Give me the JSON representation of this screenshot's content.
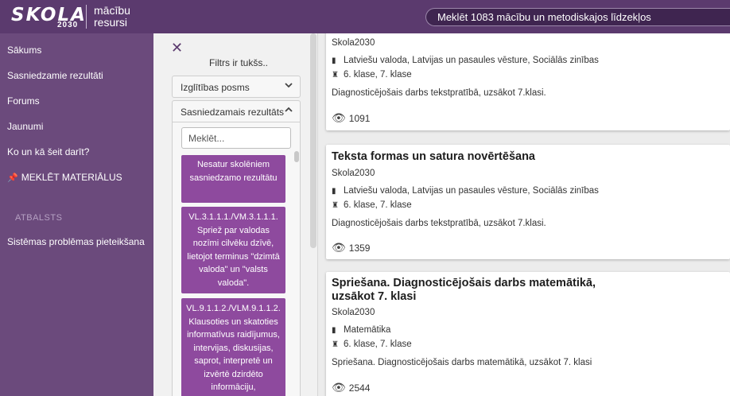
{
  "header": {
    "logo_word": "SKOLA",
    "logo_year": "2030",
    "logo_sub_line1": "mācību",
    "logo_sub_line2": "resursi",
    "search_placeholder": "Meklēt 1083 mācību un metodiskajos līdzekļos",
    "brand_color": "#5b3a6e"
  },
  "sidebar": {
    "items": [
      {
        "label": "Sākums"
      },
      {
        "label": "Sasniedzamie rezultāti"
      },
      {
        "label": "Forums"
      },
      {
        "label": "Jaunumi"
      },
      {
        "label": "Ko un kā šeit darīt?"
      },
      {
        "label": "MEKLĒT MATERIĀLUS",
        "icon": "pin-icon"
      }
    ],
    "section_label": "ATBALSTS",
    "support_items": [
      {
        "label": "Sistēmas problēmas pieteikšana"
      }
    ]
  },
  "filters": {
    "close_icon": "close-icon",
    "empty_text": "Filtrs ir tukšs..",
    "accordions": [
      {
        "label": "Izglītības posms",
        "state": "collapsed"
      },
      {
        "label": "Sasniedzamais rezultāts",
        "state": "expanded"
      }
    ],
    "mini_search_placeholder": "Meklēt...",
    "options": [
      {
        "text": "Nesatur skolēniem sasniedzamo rezultātu"
      },
      {
        "text": "VL.3.1.1.1./VM.3.1.1.1. Spriež par valodas nozīmi cilvēku dzīvē, lietojot terminus \"dzimtā valoda\" un \"valsts valoda\"."
      },
      {
        "text": "VL.9.1.1.2./VLM.9.1.1.2. Klausoties un skatoties informatīvus raidījumus, intervijas, diskusijas, saprot, interpretē un izvērtē dzirdēto informāciju,"
      }
    ],
    "option_color": "#8e4a9e"
  },
  "cards": [
    {
      "title": "",
      "author": "Skola2030",
      "subjects": "Latviešu valoda, Latvijas un pasaules vēsture, Sociālās zinības",
      "grades": "6. klase, 7. klase",
      "description": "Diagnosticējošais darbs tekstpratībā, uzsākot 7.klasi.",
      "views": "1091"
    },
    {
      "title": "Teksta formas un satura novērtēšana",
      "author": "Skola2030",
      "subjects": "Latviešu valoda, Latvijas un pasaules vēsture, Sociālās zinības",
      "grades": "6. klase, 7. klase",
      "description": "Diagnosticējošais darbs tekstpratībā, uzsākot 7.klasi.",
      "views": "1359"
    },
    {
      "title": "Spriešana. Diagnosticējošais darbs matemātikā, uzsākot 7. klasi",
      "author": "Skola2030",
      "subjects": "Matemātika",
      "grades": "6. klase, 7. klase",
      "description": "Spriešana. Diagnosticējošais darbs matemātikā, uzsākot 7. klasi",
      "views": "2544"
    }
  ]
}
